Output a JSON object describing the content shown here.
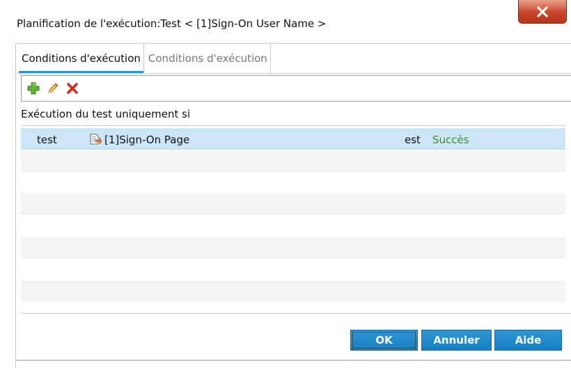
{
  "window": {
    "title": "Planification de l'exécution:Test < [1]Sign-On User Name >",
    "close_label": "X"
  },
  "tabs": [
    {
      "label": "Conditions d'exécution",
      "active": true
    },
    {
      "label": "Conditions d'exécution",
      "active": false
    }
  ],
  "toolbar": {
    "add_icon": "plus-icon",
    "edit_icon": "pencil-icon",
    "delete_icon": "delete-x-icon"
  },
  "conditions": {
    "label": "Exécution du test uniquement si",
    "rows": [
      {
        "test": "test",
        "page": "[1]Sign-On Page",
        "operator": "est",
        "status": "Succès"
      }
    ]
  },
  "buttons": {
    "ok": "OK",
    "cancel": "Annuler",
    "help": "Aide"
  },
  "colors": {
    "accent": "#2a9ad6",
    "button": "#1680c2",
    "selected_row": "#cde6f7",
    "status_text": "#4a8a2a",
    "close_button": "#c8462c"
  }
}
